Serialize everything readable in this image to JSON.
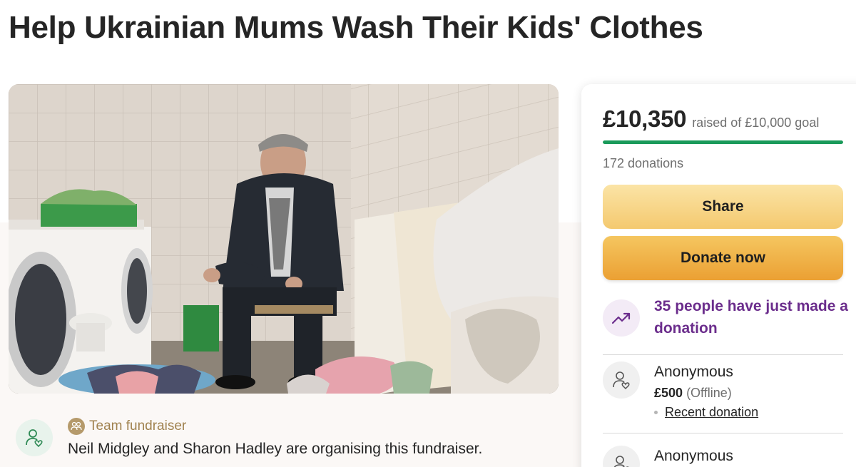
{
  "page": {
    "title": "Help Ukrainian Mums Wash Their Kids' Clothes"
  },
  "organizer": {
    "badge_label": "Team fundraiser",
    "description": "Neil Midgley and Sharon Hadley are organising this fundraiser.",
    "avatar_icon": "person-heart-icon",
    "badge_icon": "team-icon"
  },
  "donation": {
    "raised": "£10,350",
    "goal_text": "raised of £10,000 goal",
    "progress_fraction": 1.0,
    "progress_color": "#1a9a5a",
    "count_text": "172 donations",
    "share_label": "Share",
    "donate_label": "Donate now",
    "trend_text": "35 people have just made a donation",
    "trend_icon": "trending-up-icon",
    "recent": [
      {
        "name": "Anonymous",
        "amount": "£500",
        "note": "(Offline)",
        "tag": "Recent donation"
      },
      {
        "name": "Anonymous"
      }
    ]
  },
  "colors": {
    "accent_purple": "#6b2d8c",
    "donate_orange": "#eba033",
    "share_yellow": "#f4c96f"
  }
}
